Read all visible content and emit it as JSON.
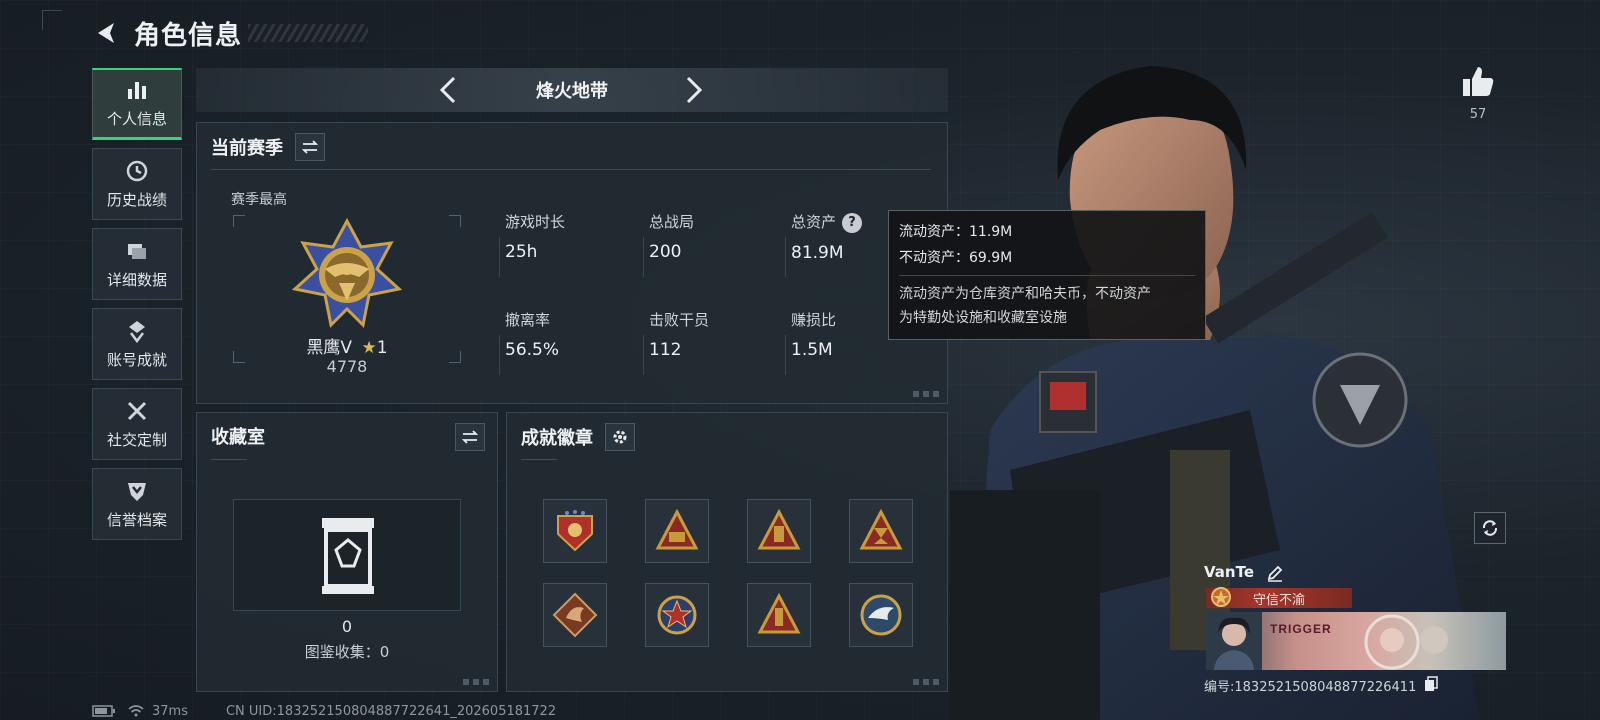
{
  "header": {
    "title": "角色信息"
  },
  "nav": {
    "items": [
      {
        "label": "个人信息",
        "icon": "bar-chart-icon",
        "active": true
      },
      {
        "label": "历史战绩",
        "icon": "clock-icon",
        "active": false
      },
      {
        "label": "详细数据",
        "icon": "folders-icon",
        "active": false
      },
      {
        "label": "账号成就",
        "icon": "achievement-icon",
        "active": false
      },
      {
        "label": "社交定制",
        "icon": "wrench-screwdriver-icon",
        "active": false
      },
      {
        "label": "信誉档案",
        "icon": "shield-chevron-icon",
        "active": false
      }
    ]
  },
  "mode": {
    "title": "烽火地带"
  },
  "season": {
    "title": "当前赛季",
    "best_label": "赛季最高",
    "rank_name": "黑鹰Ⅴ",
    "rank_stars": "1",
    "rank_score": "4778",
    "stats": [
      {
        "label": "游戏时长",
        "value": "25h"
      },
      {
        "label": "总战局",
        "value": "200"
      },
      {
        "label": "总资产",
        "value": "81.9M"
      },
      {
        "label": "撤离率",
        "value": "56.5%"
      },
      {
        "label": "击败干员",
        "value": "112"
      },
      {
        "label": "赚损比",
        "value": "1.5M"
      }
    ]
  },
  "tooltip": {
    "liquid": "流动资产：11.9M",
    "fixed": "不动资产：69.9M",
    "note_line1": "流动资产为仓库资产和哈夫币，不动资产",
    "note_line2": "为特勤处设施和收藏室设施"
  },
  "collection": {
    "title": "收藏室",
    "count": "0",
    "catalog_label": "图鉴收集：0"
  },
  "badges": {
    "title": "成就徽章",
    "items": [
      {
        "icon": "red-shield-badge-icon",
        "color": "#b0302a"
      },
      {
        "icon": "gold-triangle-badge-icon",
        "color": "#c89a3c"
      },
      {
        "icon": "gold-triangle-badge-icon",
        "color": "#c89a3c"
      },
      {
        "icon": "gold-triangle-badge-icon",
        "color": "#c89a3c"
      },
      {
        "icon": "dragon-badge-icon",
        "color": "#b86a3a"
      },
      {
        "icon": "star-medal-badge-icon",
        "color": "#b0302a"
      },
      {
        "icon": "gold-triangle-badge-icon",
        "color": "#c89a3c"
      },
      {
        "icon": "eagle-round-badge-icon",
        "color": "#2e4a6a"
      }
    ]
  },
  "profile": {
    "likes": "57",
    "name": "VanTe",
    "title_badge": "守信不渝",
    "name_card_text": "TRIGGER",
    "id_text": "编号:1832521508048877226411"
  },
  "status": {
    "ping": "37ms",
    "uid": "CN UID:183252150804887722641_202605181722"
  },
  "colors": {
    "accent_green": "#35d57a",
    "panel_bg": "#222b32",
    "title_badge_red": "#a8352a"
  }
}
